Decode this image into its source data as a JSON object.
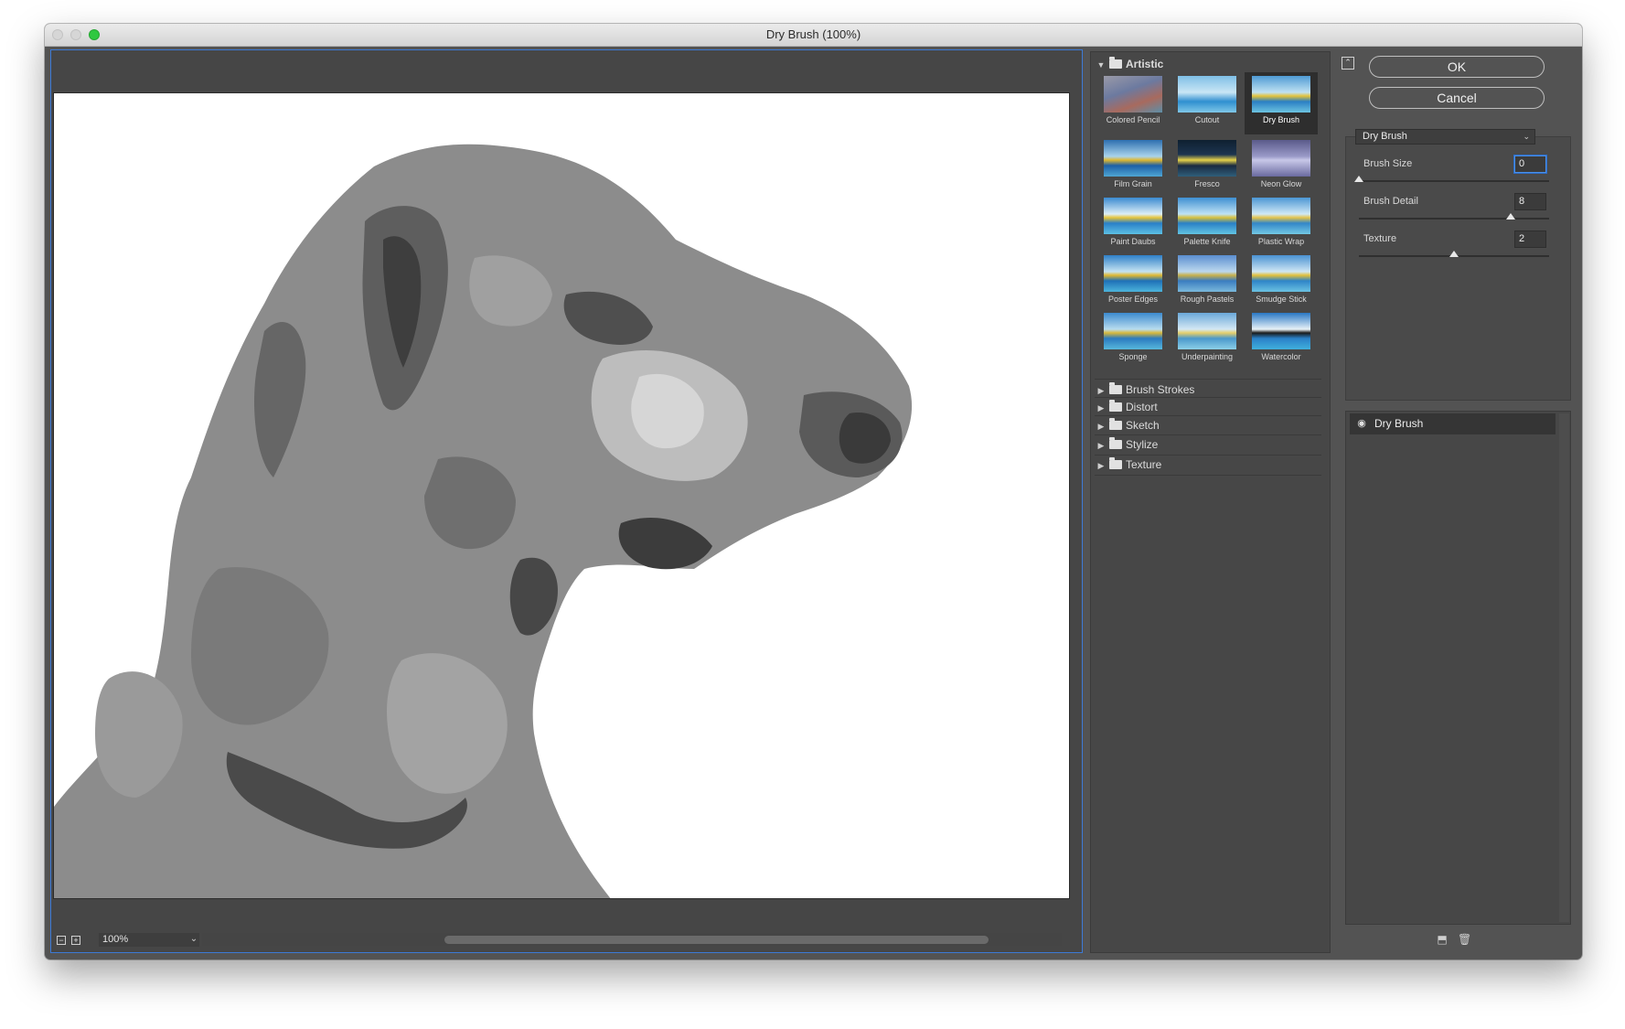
{
  "window": {
    "title": "Dry Brush (100%)"
  },
  "preview": {
    "zoom_label": "100%",
    "zoom_out_icon": "minus-icon",
    "zoom_in_icon": "plus-icon"
  },
  "gallery": {
    "open_category": "Artistic",
    "filters": [
      {
        "label": "Colored Pencil"
      },
      {
        "label": "Cutout"
      },
      {
        "label": "Dry Brush",
        "selected": true
      },
      {
        "label": "Film Grain"
      },
      {
        "label": "Fresco"
      },
      {
        "label": "Neon Glow"
      },
      {
        "label": "Paint Daubs"
      },
      {
        "label": "Palette Knife"
      },
      {
        "label": "Plastic Wrap"
      },
      {
        "label": "Poster Edges"
      },
      {
        "label": "Rough Pastels"
      },
      {
        "label": "Smudge Stick"
      },
      {
        "label": "Sponge"
      },
      {
        "label": "Underpainting"
      },
      {
        "label": "Watercolor"
      }
    ],
    "categories": [
      "Brush Strokes",
      "Distort",
      "Sketch",
      "Stylize",
      "Texture"
    ]
  },
  "actions": {
    "ok": "OK",
    "cancel": "Cancel"
  },
  "settings": {
    "selected_filter": "Dry Brush",
    "params": [
      {
        "label": "Brush Size",
        "value": "0",
        "level": 0.0
      },
      {
        "label": "Brush Detail",
        "value": "8",
        "level": 0.8
      },
      {
        "label": "Texture",
        "value": "2",
        "level": 0.5
      }
    ]
  },
  "layers": {
    "items": [
      {
        "name": "Dry Brush",
        "visible_icon": "eye-icon"
      }
    ]
  },
  "bottom_icons": [
    "new-layer-icon",
    "trash-icon"
  ],
  "colors": {
    "selection_blue": "#3d7ad6",
    "close_green": "#2fc840"
  }
}
